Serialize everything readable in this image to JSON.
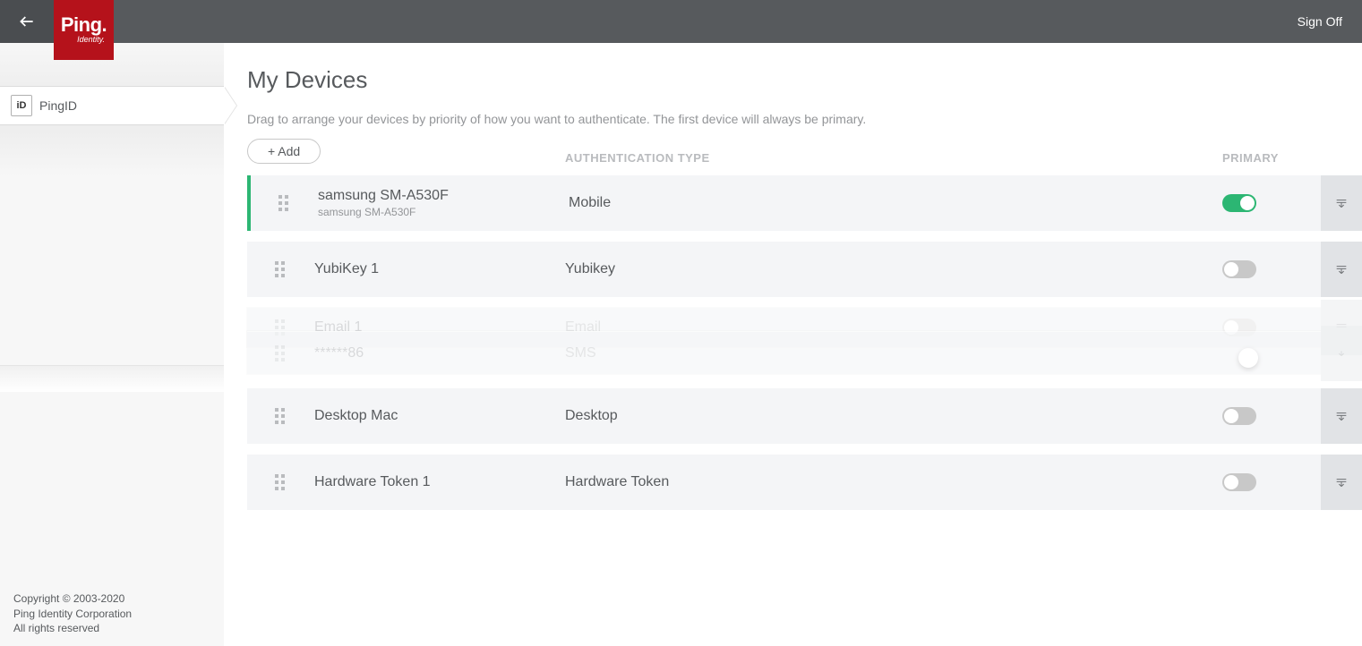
{
  "header": {
    "sign_off": "Sign Off",
    "logo_main": "Ping",
    "logo_sub": "Identity."
  },
  "sidebar": {
    "nav_label": "PingID",
    "nav_badge": "iD"
  },
  "footer": {
    "line1": "Copyright © 2003-2020",
    "line2": "Ping Identity Corporation",
    "line3": "All rights reserved"
  },
  "page": {
    "title": "My Devices",
    "subtitle": "Drag to arrange your devices by priority of how you want to authenticate. The first device will always be primary.",
    "add_label": "+ Add"
  },
  "columns": {
    "type": "AUTHENTICATION TYPE",
    "primary": "PRIMARY"
  },
  "devices": [
    {
      "name": "samsung SM-A530F",
      "sub": "samsung SM-A530F",
      "type": "Mobile",
      "primary": true
    },
    {
      "name": "YubiKey 1",
      "sub": "",
      "type": "Yubikey",
      "primary": false
    },
    {
      "name": "Email 1",
      "sub": "",
      "type": "Email",
      "primary": false
    },
    {
      "name": "******86",
      "sub": "",
      "type": "SMS",
      "primary": false
    },
    {
      "name": "Desktop Mac",
      "sub": "",
      "type": "Desktop",
      "primary": false
    },
    {
      "name": "Hardware Token 1",
      "sub": "",
      "type": "Hardware Token",
      "primary": false
    }
  ]
}
